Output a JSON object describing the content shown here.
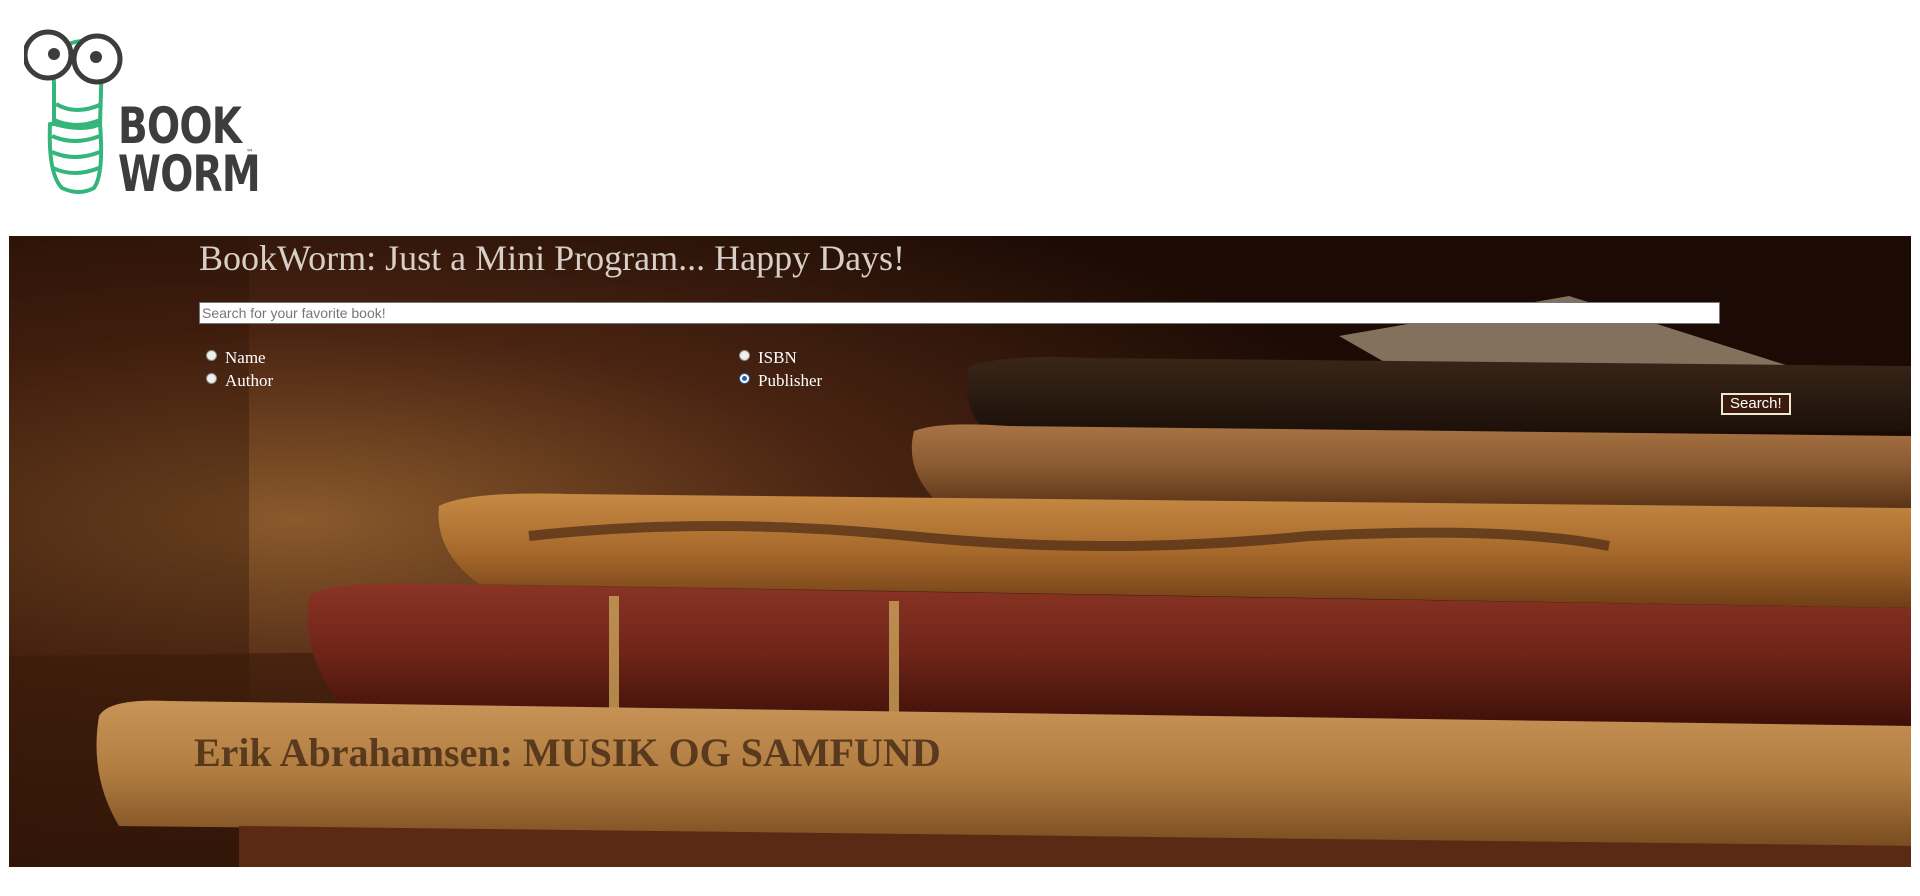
{
  "logo": {
    "line1": "BOOK",
    "line2": "WORM",
    "trademark": "™",
    "worm_color": "#34b57a",
    "glasses_color": "#3d3d3d"
  },
  "hero": {
    "title": "BookWorm: Just a Mini Program... Happy Days!",
    "background_image": "stack of old leather-bound books",
    "book_spine_text": "Erik Abrahamsen: MUSIK OG SAMFUND",
    "search": {
      "placeholder": "Search for your favorite book!",
      "value": ""
    },
    "options": {
      "name_label": "Name",
      "author_label": "Author",
      "isbn_label": "ISBN",
      "publisher_label": "Publisher",
      "selected": "Publisher"
    },
    "search_button_label": "Search!"
  }
}
